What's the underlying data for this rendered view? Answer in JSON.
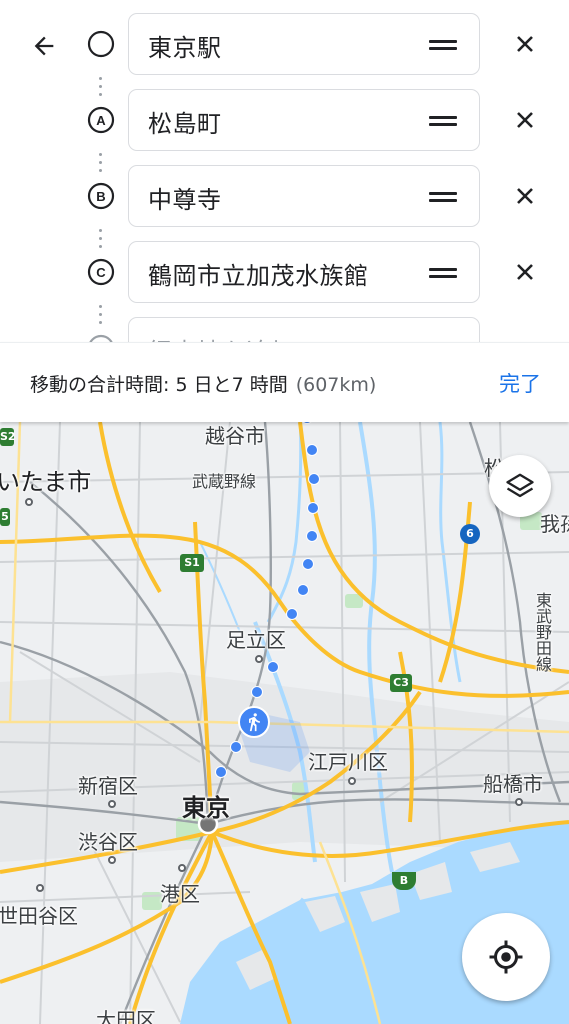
{
  "route_editor": {
    "stops": [
      {
        "marker": "",
        "label": "東京駅"
      },
      {
        "marker": "A",
        "label": "松島町"
      },
      {
        "marker": "B",
        "label": "中尊寺"
      },
      {
        "marker": "C",
        "label": "鶴岡市立加茂水族館"
      },
      {
        "marker": "",
        "label": "経由地を追加"
      }
    ]
  },
  "summary": {
    "total_label": "移動の合計時間: 5 日と7 時間",
    "distance": "(607km)",
    "done_label": "完了"
  },
  "map": {
    "labels": {
      "koshigaya": "越谷市",
      "saitama": "いたま市",
      "musashino_line": "武蔵野線",
      "adachi": "足立区",
      "edogawa": "江戸川区",
      "shinjuku": "新宿区",
      "tokyo": "東京",
      "funabashi": "船橋市",
      "shibuya": "渋谷区",
      "minato": "港区",
      "setagaya": "世田谷区",
      "ota": "大田区",
      "tobu_noda_line": "東武野田線",
      "abiko": "我孫",
      "matsudo_partial": "松"
    },
    "badges": {
      "s2": "S2",
      "s1": "S1",
      "c3": "C3",
      "b": "B",
      "r6": "6",
      "r5": "5"
    },
    "icons": {
      "layers": "layers-icon",
      "locate": "my-location-icon",
      "travel_mode": "walking-icon"
    },
    "colors": {
      "route": "#4285f4",
      "water": "#aadaff",
      "highway": "#fbc02d",
      "park": "#c5e8c5"
    }
  }
}
